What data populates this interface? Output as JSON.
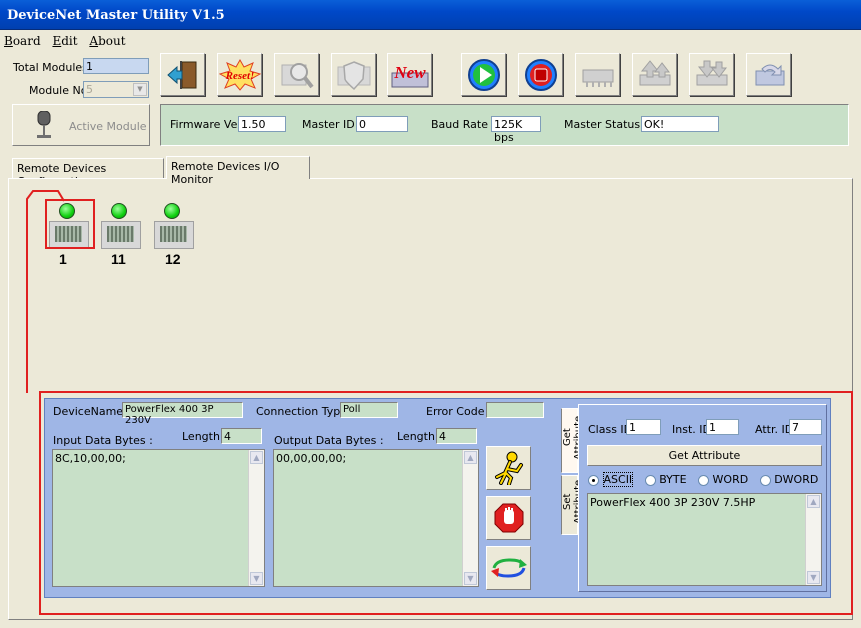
{
  "window": {
    "title": "DeviceNet Master Utility V1.5"
  },
  "menu": {
    "items": [
      "Board",
      "Edit",
      "About"
    ]
  },
  "left": {
    "total_modules_label": "Total Modules",
    "total_modules_value": "1",
    "module_no_label": "Module No",
    "module_no_value": "5",
    "active_module_label": "Active Module"
  },
  "status": {
    "firmware_label": "Firmware Ver :",
    "firmware_value": "1.50",
    "master_id_label": "Master ID :",
    "master_id_value": "0",
    "baud_label": "Baud Rate :",
    "baud_value": "125K bps",
    "master_status_label": "Master Status :",
    "master_status_value": "OK!"
  },
  "tabs": [
    "Remote Devices Configuration",
    "Remote Devices I/O Monitor"
  ],
  "devices": [
    "1",
    "11",
    "12"
  ],
  "io": {
    "device_name_label": "DeviceName :",
    "device_name_value": "PowerFlex 400 3P 230V",
    "connection_type_label": "Connection Type :",
    "connection_type_value": "Poll",
    "error_code_label": "Error Code :",
    "error_code_value": "",
    "input_label": "Input Data  Bytes :",
    "input_length_label": "Length :",
    "input_length_value": "4",
    "input_data": "8C,10,00,00;",
    "output_label": "Output Data  Bytes :",
    "output_length_label": "Length :",
    "output_length_value": "4",
    "output_data": "00,00,00,00;"
  },
  "attr": {
    "tab_get": "Get Attribute",
    "tab_set": "Set Attribute",
    "class_id_label": "Class ID",
    "class_id_value": "1",
    "inst_id_label": "Inst. ID",
    "inst_id_value": "1",
    "attr_id_label": "Attr. ID",
    "attr_id_value": "7",
    "get_button": "Get Attribute",
    "formats": [
      "ASCII",
      "BYTE",
      "WORD",
      "DWORD"
    ],
    "selected_format": "ASCII",
    "result": "PowerFlex 400 3P 230V  7.5HP"
  },
  "colors": {
    "annotation_red": "#e02020",
    "panel_green": "#c8e0c8",
    "panel_blue": "#9fb6e6"
  }
}
